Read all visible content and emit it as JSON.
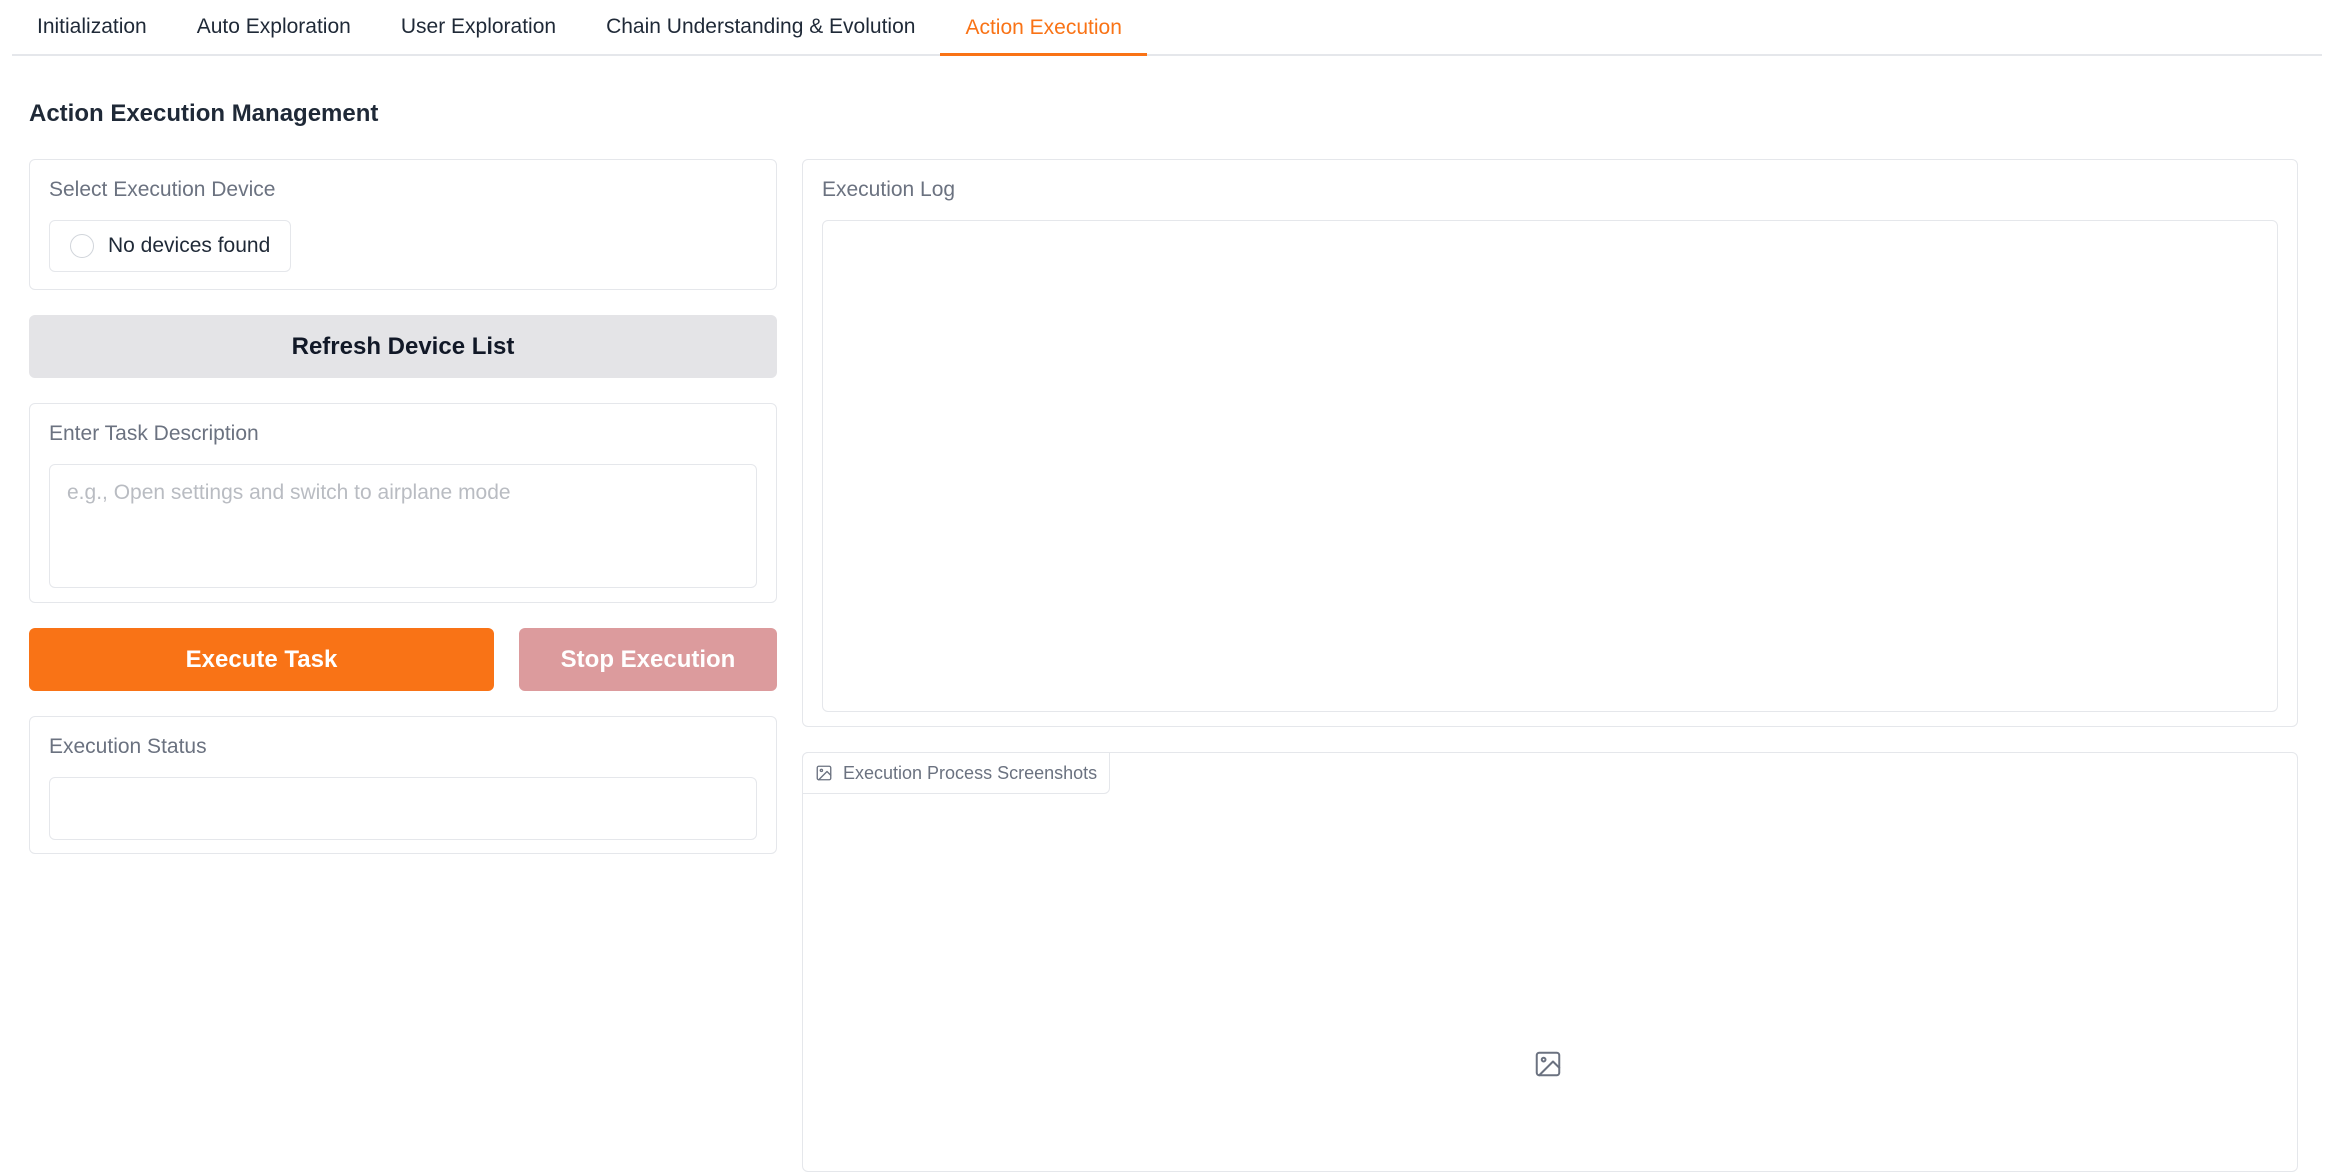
{
  "tabs": [
    {
      "label": "Initialization",
      "active": false
    },
    {
      "label": "Auto Exploration",
      "active": false
    },
    {
      "label": "User Exploration",
      "active": false
    },
    {
      "label": "Chain Understanding & Evolution",
      "active": false
    },
    {
      "label": "Action Execution",
      "active": true
    }
  ],
  "page": {
    "title": "Action Execution Management"
  },
  "device_select": {
    "label": "Select Execution Device",
    "option": "No devices found",
    "selected": false
  },
  "refresh_button": {
    "label": "Refresh Device List"
  },
  "task": {
    "label": "Enter Task Description",
    "placeholder": "e.g., Open settings and switch to airplane mode",
    "value": ""
  },
  "execute_button": {
    "label": "Execute Task"
  },
  "stop_button": {
    "label": "Stop Execution"
  },
  "status": {
    "label": "Execution Status",
    "value": ""
  },
  "log": {
    "label": "Execution Log",
    "value": ""
  },
  "screenshots": {
    "label": "Execution Process Screenshots",
    "icon": "image-icon"
  },
  "colors": {
    "accent": "#f97316",
    "stop": "#dc9b9d",
    "secondary": "#e4e4e7"
  }
}
